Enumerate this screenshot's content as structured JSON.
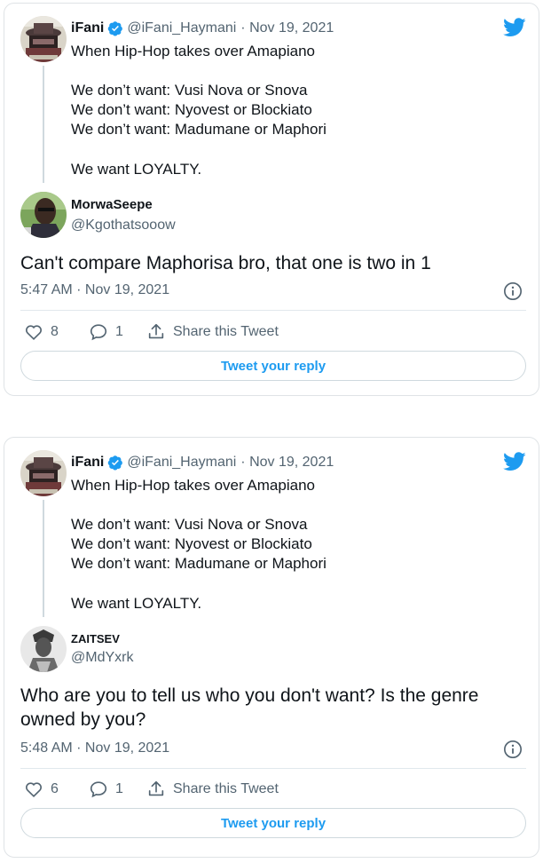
{
  "colors": {
    "accent": "#1d9bf0",
    "muted": "#536471",
    "text": "#0f1419",
    "border": "#dfe3e6"
  },
  "cards": [
    {
      "original": {
        "name": "iFani",
        "handle": "@iFani_Haymani",
        "date": "· Nov 19, 2021",
        "lines": [
          "When Hip-Hop takes over Amapiano",
          "We don’t want: Vusi Nova or Snova",
          "We don’t want: Nyovest or Blockiato",
          "We don’t want: Madumane or Maphori",
          "We want LOYALTY."
        ]
      },
      "reply": {
        "name": "MorwaSeepe",
        "handle": "@Kgothatsooow",
        "text_lines": [
          "Can't compare Maphorisa bro, that one is two in 1"
        ],
        "timestamp": "5:47 AM · Nov 19, 2021"
      },
      "actions": {
        "likes": "8",
        "replies": "1",
        "share": "Share this Tweet"
      },
      "reply_button": "Tweet your reply"
    },
    {
      "original": {
        "name": "iFani",
        "handle": "@iFani_Haymani",
        "date": "· Nov 19, 2021",
        "lines": [
          "When Hip-Hop takes over Amapiano",
          "We don’t want: Vusi Nova or Snova",
          "We don’t want: Nyovest or Blockiato",
          "We don’t want: Madumane or Maphori",
          "We want LOYALTY."
        ]
      },
      "reply": {
        "name": "ZAITSEV",
        "handle": "@MdYxrk",
        "text_lines": [
          "Who are you to tell us who you don't want? Is the genre",
          "owned by you?"
        ],
        "timestamp": "5:48 AM · Nov 19, 2021"
      },
      "actions": {
        "likes": "6",
        "replies": "1",
        "share": "Share this Tweet"
      },
      "reply_button": "Tweet your reply"
    }
  ],
  "icons": [
    "twitter-bird-icon",
    "verified-badge-icon",
    "info-icon",
    "heart-icon",
    "reply-bubble-icon",
    "share-icon"
  ]
}
